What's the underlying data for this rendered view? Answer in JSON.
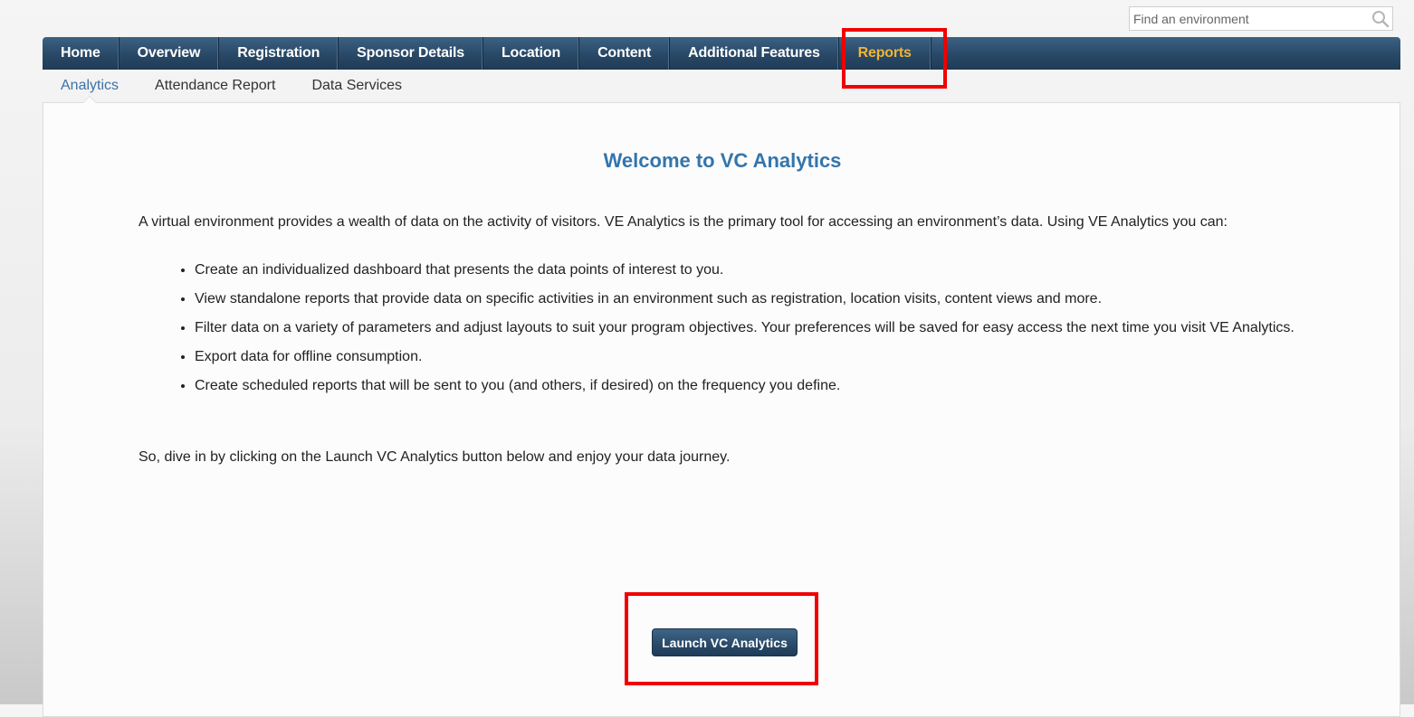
{
  "search": {
    "placeholder": "Find an environment",
    "icon": "search-icon"
  },
  "nav": {
    "items": [
      {
        "label": "Home",
        "active": false
      },
      {
        "label": "Overview",
        "active": false
      },
      {
        "label": "Registration",
        "active": false
      },
      {
        "label": "Sponsor Details",
        "active": false
      },
      {
        "label": "Location",
        "active": false
      },
      {
        "label": "Content",
        "active": false
      },
      {
        "label": "Additional Features",
        "active": false
      },
      {
        "label": "Reports",
        "active": true
      }
    ],
    "active_color": "#f0b436"
  },
  "subnav": {
    "items": [
      {
        "label": "Analytics",
        "active": true
      },
      {
        "label": "Attendance Report",
        "active": false
      },
      {
        "label": "Data Services",
        "active": false
      }
    ]
  },
  "main": {
    "title": "Welcome to VC Analytics",
    "intro": "A virtual environment provides a wealth of data on the activity of visitors.  VE Analytics is the primary tool for accessing an environment’s data.  Using VE Analytics you can:",
    "features": [
      "Create an individualized dashboard that presents the data points of interest to you.",
      "View standalone reports that provide data on specific activities in an environment such as registration, location visits, content views and more.",
      "Filter data on a variety of parameters and adjust layouts to suit your program objectives.  Your preferences will be saved for easy access the next time you visit VE Analytics.",
      "Export data for offline consumption.",
      "Create scheduled reports that will be sent to you (and others, if desired) on the frequency you define."
    ],
    "outro": "So, dive in by clicking on the Launch VC Analytics button below and enjoy your data journey.",
    "launch_label": "Launch VC Analytics"
  },
  "colors": {
    "title": "#3475ab",
    "nav_bg": "#2a4a69",
    "highlight": "#f00000"
  }
}
